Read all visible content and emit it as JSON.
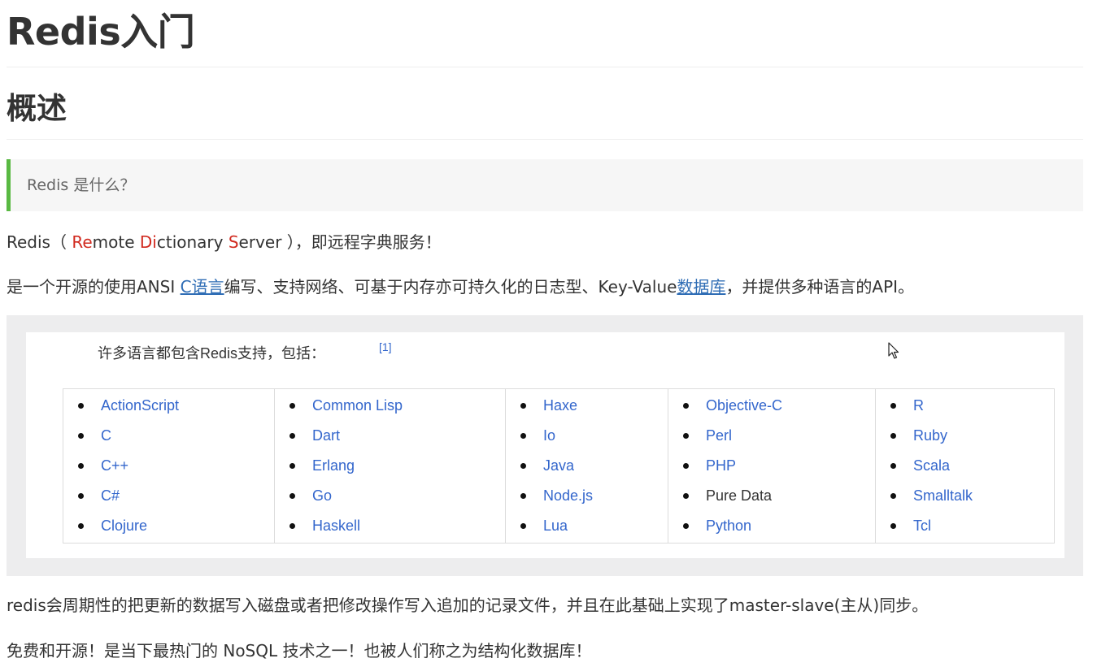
{
  "heading1": "Redis入门",
  "heading2": "概述",
  "blockquote": "Redis 是什么？",
  "para1": {
    "prefix": "Redis（ ",
    "re": "Re",
    "mote": "mote ",
    "di": "Di",
    "ctionary": "ctionary ",
    "s": "S",
    "erver": "erver ）",
    "suffix": "，即远程字典服务！"
  },
  "para2": {
    "text1": "是一个开源的使用ANSI ",
    "link1": "C语言",
    "text2": "编写、支持网络、可基于内存亦可持久化的日志型、Key-Value",
    "link2": "数据库",
    "text3": "，并提供多种语言的API。"
  },
  "figure": {
    "caption": "许多语言都包含Redis支持，包括：",
    "citation": "[1]",
    "columns": [
      [
        "ActionScript",
        "C",
        "C++",
        "C#",
        "Clojure"
      ],
      [
        "Common Lisp",
        "Dart",
        "Erlang",
        "Go",
        "Haskell"
      ],
      [
        "Haxe",
        "Io",
        "Java",
        "Node.js",
        "Lua"
      ],
      [
        "Objective-C",
        "Perl",
        "PHP",
        "Pure Data",
        "Python"
      ],
      [
        "R",
        "Ruby",
        "Scala",
        "Smalltalk",
        "Tcl"
      ]
    ],
    "unlinked": [
      "Pure Data"
    ]
  },
  "para3": "redis会周期性的把更新的数据写入磁盘或者把修改操作写入追加的记录文件，并且在此基础上实现了master-slave(主从)同步。",
  "para4": "免费和开源！是当下最热门的 NoSQL 技术之一！也被人们称之为结构化数据库！",
  "colors": {
    "text": "#333333",
    "link": "#3366cc",
    "accent_red": "#d12a1f",
    "quote_border": "#59b942"
  }
}
